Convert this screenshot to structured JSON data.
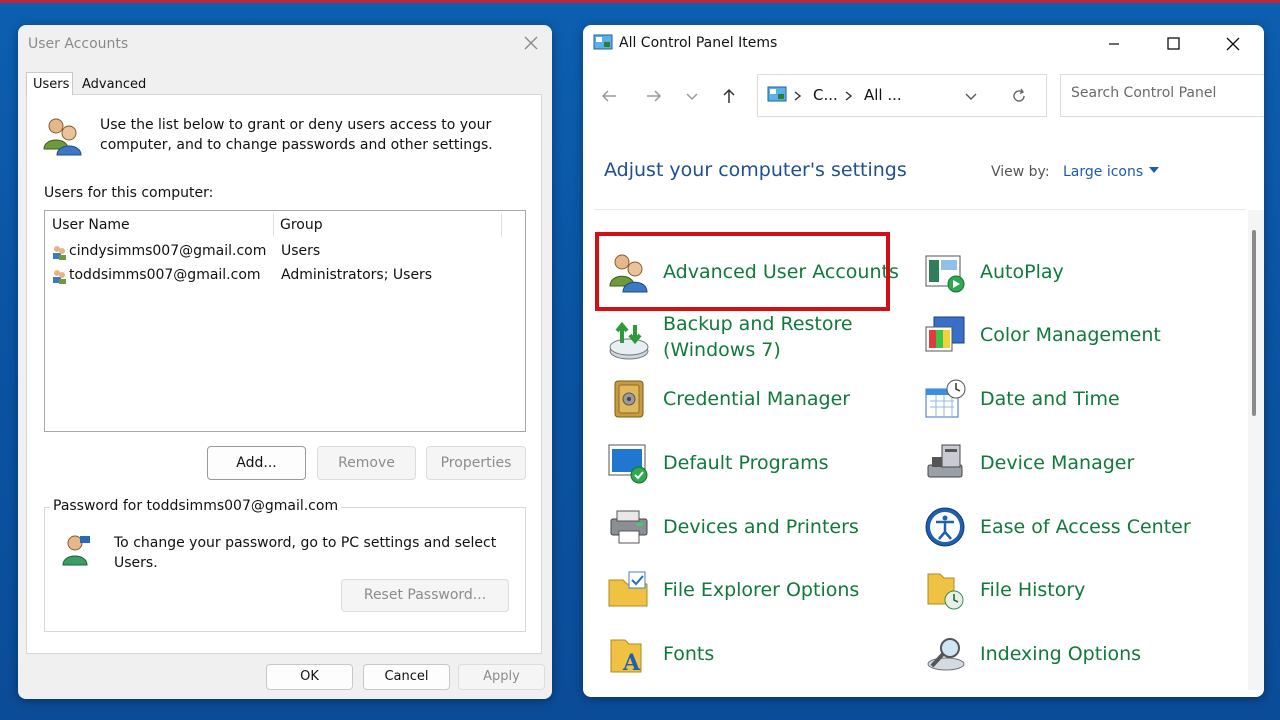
{
  "user_accounts": {
    "title": "User Accounts",
    "tabs": {
      "users": "Users",
      "advanced": "Advanced"
    },
    "intro": "Use the list below to grant or deny users access to your computer, and to change passwords and other settings.",
    "users_label": "Users for this computer:",
    "columns": {
      "name": "User Name",
      "group": "Group"
    },
    "rows": [
      {
        "name": "cindysimms007@gmail.com",
        "group": "Users"
      },
      {
        "name": "toddsimms007@gmail.com",
        "group": "Administrators; Users"
      }
    ],
    "buttons": {
      "add": "Add...",
      "remove": "Remove",
      "properties": "Properties"
    },
    "password_group_label": "Password for toddsimms007@gmail.com",
    "password_text": "To change your password, go to PC settings and select Users.",
    "reset_button": "Reset Password...",
    "footer": {
      "ok": "OK",
      "cancel": "Cancel",
      "apply": "Apply"
    }
  },
  "control_panel": {
    "title": "All Control Panel Items",
    "address": {
      "crumb1": "C...",
      "crumb2": "All ..."
    },
    "search_placeholder": "Search Control Panel",
    "heading": "Adjust your computer's settings",
    "view_by_label": "View by:",
    "view_by_value": "Large icons",
    "left_items": [
      {
        "label": "Advanced User Accounts",
        "icon": "users-icon"
      },
      {
        "label": "Backup and Restore (Windows 7)",
        "icon": "backup-icon"
      },
      {
        "label": "Credential Manager",
        "icon": "vault-icon"
      },
      {
        "label": "Default Programs",
        "icon": "default-programs-icon"
      },
      {
        "label": "Devices and Printers",
        "icon": "printer-icon"
      },
      {
        "label": "File Explorer Options",
        "icon": "folder-options-icon"
      },
      {
        "label": "Fonts",
        "icon": "fonts-icon"
      }
    ],
    "right_items": [
      {
        "label": "AutoPlay",
        "icon": "autoplay-icon"
      },
      {
        "label": "Color Management",
        "icon": "color-management-icon"
      },
      {
        "label": "Date and Time",
        "icon": "calendar-clock-icon"
      },
      {
        "label": "Device Manager",
        "icon": "device-manager-icon"
      },
      {
        "label": "Ease of Access Center",
        "icon": "ease-of-access-icon"
      },
      {
        "label": "File History",
        "icon": "file-history-icon"
      },
      {
        "label": "Indexing Options",
        "icon": "indexing-icon"
      }
    ]
  },
  "colors": {
    "highlight": "#d20f16",
    "link_green": "#0f7a3b",
    "heading_blue": "#1e4f8f"
  }
}
